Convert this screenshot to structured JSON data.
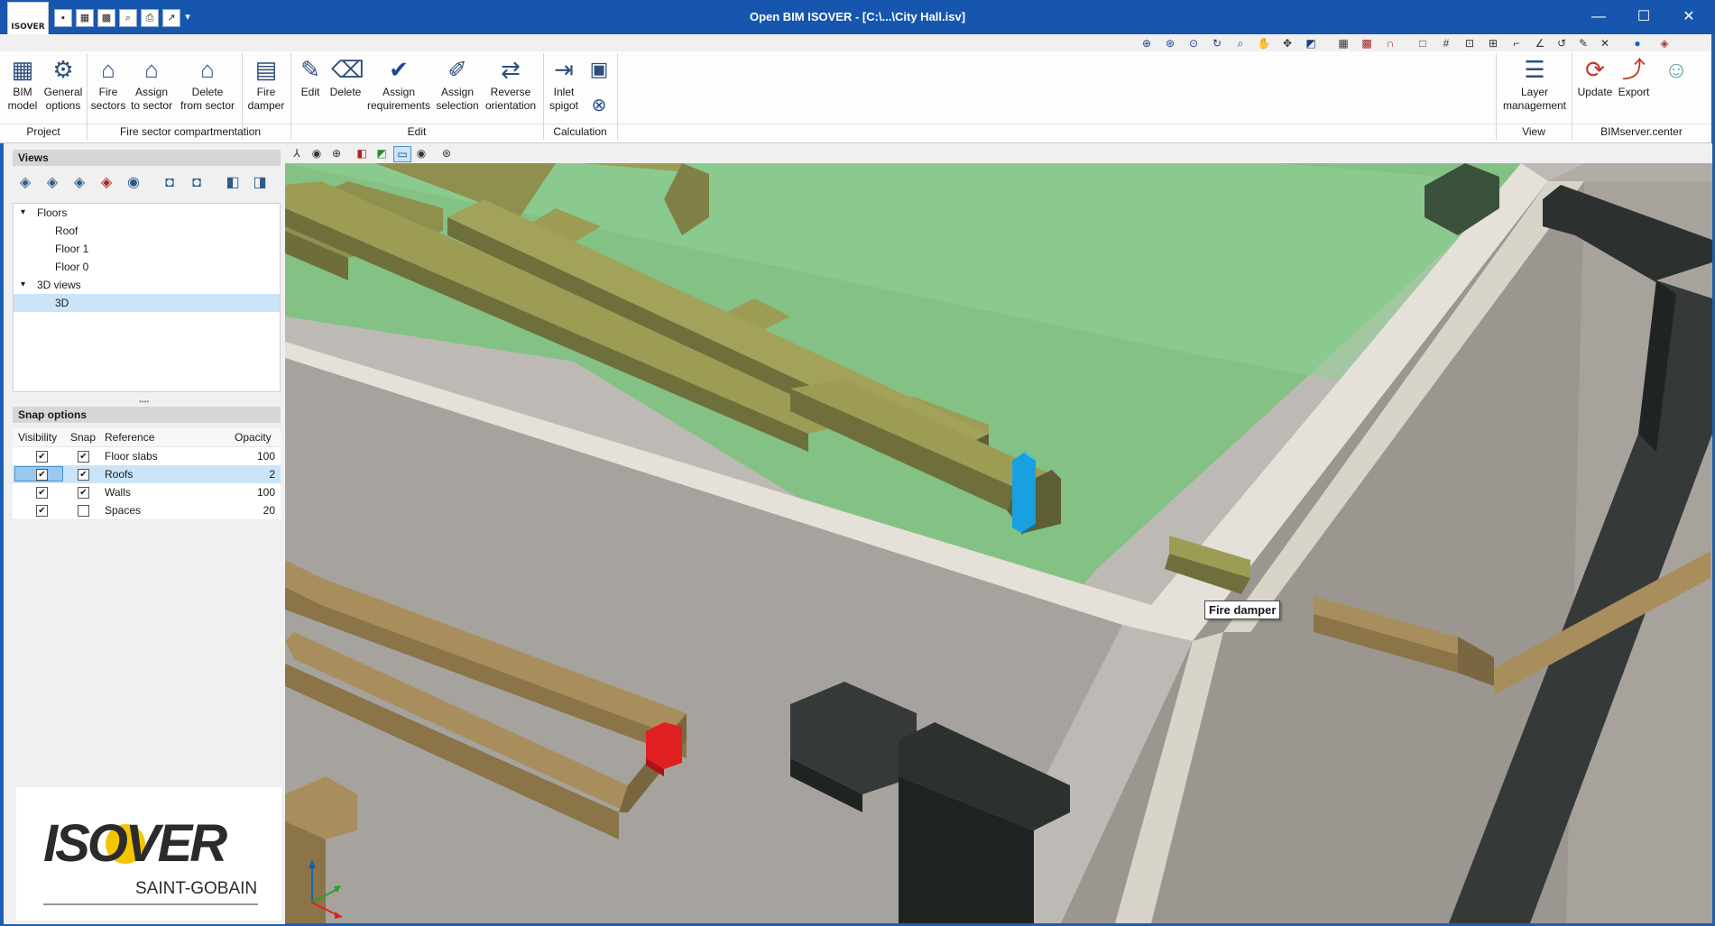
{
  "window": {
    "title": "Open BIM ISOVER - [C:\\...\\City Hall.isv]",
    "minimize": "—",
    "maximize": "☐",
    "close": "✕"
  },
  "logo_small": "ISOVER",
  "ribbon": {
    "groups": [
      {
        "label": "Project",
        "buttons": [
          {
            "label": "BIM\nmodel",
            "icon": "grid-icon"
          },
          {
            "label": "General\noptions",
            "icon": "gear-icon"
          }
        ]
      },
      {
        "label": "Fire sector compartmentation",
        "buttons": [
          {
            "label": "Fire\nsectors",
            "icon": "fire-sectors-icon"
          },
          {
            "label": "Assign\nto sector",
            "icon": "assign-sector-icon"
          },
          {
            "label": "Delete\nfrom sector",
            "icon": "delete-sector-icon"
          },
          {
            "label": "Fire\ndamper",
            "icon": "fire-damper-icon"
          }
        ]
      },
      {
        "label": "Edit",
        "buttons": [
          {
            "label": "Edit",
            "icon": "pencil-icon"
          },
          {
            "label": "Delete",
            "icon": "eraser-icon"
          },
          {
            "label": "Assign\nrequirements",
            "icon": "check-circle-icon"
          },
          {
            "label": "Assign\nselection",
            "icon": "brush-icon"
          },
          {
            "label": "Reverse\norientation",
            "icon": "reverse-icon"
          }
        ]
      },
      {
        "label": "Calculation",
        "buttons": [
          {
            "label": "Inlet\nspigot",
            "icon": "inlet-spigot-icon"
          }
        ]
      },
      {
        "label": "View",
        "buttons": [
          {
            "label": "Layer\nmanagement",
            "icon": "layers-icon"
          }
        ]
      },
      {
        "label": "BIMserver.center",
        "buttons": [
          {
            "label": "Update",
            "icon": "update-icon"
          },
          {
            "label": "Export",
            "icon": "export-icon"
          }
        ]
      }
    ]
  },
  "views_panel": {
    "title": "Views",
    "tree": [
      {
        "label": "Floors",
        "level": 0,
        "expanded": true
      },
      {
        "label": "Roof",
        "level": 1
      },
      {
        "label": "Floor 1",
        "level": 1
      },
      {
        "label": "Floor 0",
        "level": 1
      },
      {
        "label": "3D views",
        "level": 0,
        "expanded": true
      },
      {
        "label": "3D",
        "level": 1,
        "selected": true
      }
    ]
  },
  "snap_panel": {
    "title": "Snap options",
    "headers": [
      "Visibility",
      "Snap",
      "Reference",
      "Opacity"
    ],
    "rows": [
      {
        "visibility": true,
        "snap": true,
        "reference": "Floor slabs",
        "opacity": "100"
      },
      {
        "visibility": true,
        "snap": true,
        "reference": "Roofs",
        "opacity": "2",
        "selected": true
      },
      {
        "visibility": true,
        "snap": true,
        "reference": "Walls",
        "opacity": "100"
      },
      {
        "visibility": true,
        "snap": false,
        "reference": "Spaces",
        "opacity": "20"
      }
    ]
  },
  "brand": {
    "name": "ISOVER",
    "parent": "SAINT-GOBAIN"
  },
  "viewport": {
    "tooltip": "Fire damper"
  },
  "colors": {
    "titlebar": "#1656ae",
    "floor": "#84c184",
    "duct": "#8f8f4e",
    "damper_selected": "#19a0e0",
    "damper_red": "#e02020",
    "wall": "#9c9690"
  }
}
